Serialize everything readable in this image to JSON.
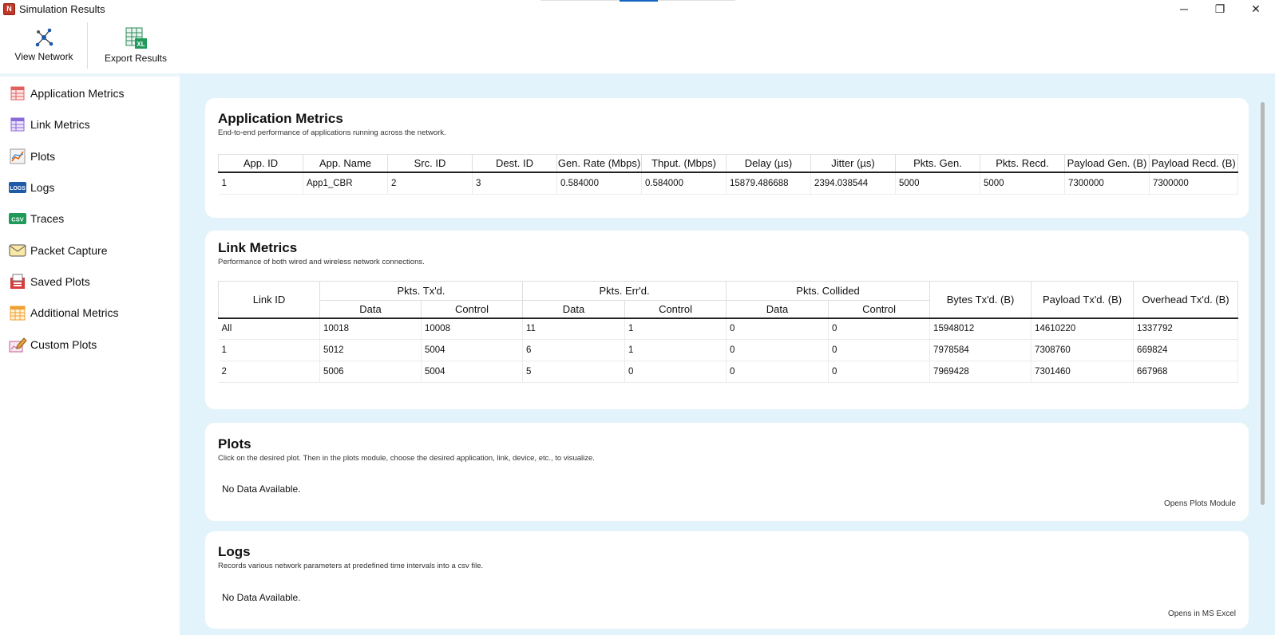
{
  "window": {
    "title": "Simulation Results",
    "minimize_glyph": "─",
    "maximize_glyph": "❐",
    "close_glyph": "✕",
    "accent": "#1565c0"
  },
  "toolbar": {
    "view_network_label": "View Network",
    "export_results_label": "Export Results"
  },
  "sidebar": {
    "items": [
      {
        "label": "Application Metrics",
        "icon": "application-metrics-icon"
      },
      {
        "label": "Link Metrics",
        "icon": "link-metrics-icon"
      },
      {
        "label": "Plots",
        "icon": "plots-icon"
      },
      {
        "label": "Logs",
        "icon": "logs-icon"
      },
      {
        "label": "Traces",
        "icon": "csv-icon"
      },
      {
        "label": "Packet Capture",
        "icon": "envelope-icon"
      },
      {
        "label": "Saved Plots",
        "icon": "saved-plots-icon"
      },
      {
        "label": "Additional Metrics",
        "icon": "calendar-icon"
      },
      {
        "label": "Custom Plots",
        "icon": "pencil-icon"
      }
    ],
    "logs_badge": "LOGS",
    "csv_badge": "CSV"
  },
  "application_metrics": {
    "title": "Application Metrics",
    "subtitle": "End-to-end performance of applications running across the network.",
    "headers": [
      "App. ID",
      "App. Name",
      "Src. ID",
      "Dest. ID",
      "Gen. Rate (Mbps)",
      "Thput. (Mbps)",
      "Delay (µs)",
      "Jitter (µs)",
      "Pkts. Gen.",
      "Pkts. Recd.",
      "Payload Gen. (B)",
      "Payload Recd. (B)"
    ],
    "rows": [
      [
        "1",
        "App1_CBR",
        "2",
        "3",
        "0.584000",
        "0.584000",
        "15879.486688",
        "2394.038544",
        "5000",
        "5000",
        "7300000",
        "7300000"
      ]
    ]
  },
  "link_metrics": {
    "title": "Link Metrics",
    "subtitle": "Performance of both wired and wireless network connections.",
    "headers": {
      "link_id": "Link ID",
      "pkts_txd": "Pkts. Tx'd.",
      "pkts_errd": "Pkts. Err'd.",
      "pkts_collided": "Pkts. Collided",
      "data": "Data",
      "control": "Control",
      "bytes_txd": "Bytes Tx'd. (B)",
      "payload_txd": "Payload Tx'd. (B)",
      "overhead_txd": "Overhead Tx'd. (B)"
    },
    "rows": [
      [
        "All",
        "10018",
        "10008",
        "11",
        "1",
        "0",
        "0",
        "15948012",
        "14610220",
        "1337792"
      ],
      [
        "1",
        "5012",
        "5004",
        "6",
        "1",
        "0",
        "0",
        "7978584",
        "7308760",
        "669824"
      ],
      [
        "2",
        "5006",
        "5004",
        "5",
        "0",
        "0",
        "0",
        "7969428",
        "7301460",
        "667968"
      ]
    ]
  },
  "plots": {
    "title": "Plots",
    "subtitle": "Click on the desired plot. Then in the plots module, choose the desired application, link, device, etc., to visualize.",
    "empty_text": "No Data Available.",
    "action": "Opens Plots Module"
  },
  "logs": {
    "title": "Logs",
    "subtitle": "Records various network parameters at predefined time intervals into a csv file.",
    "empty_text": "No Data Available.",
    "action": "Opens in MS Excel"
  }
}
